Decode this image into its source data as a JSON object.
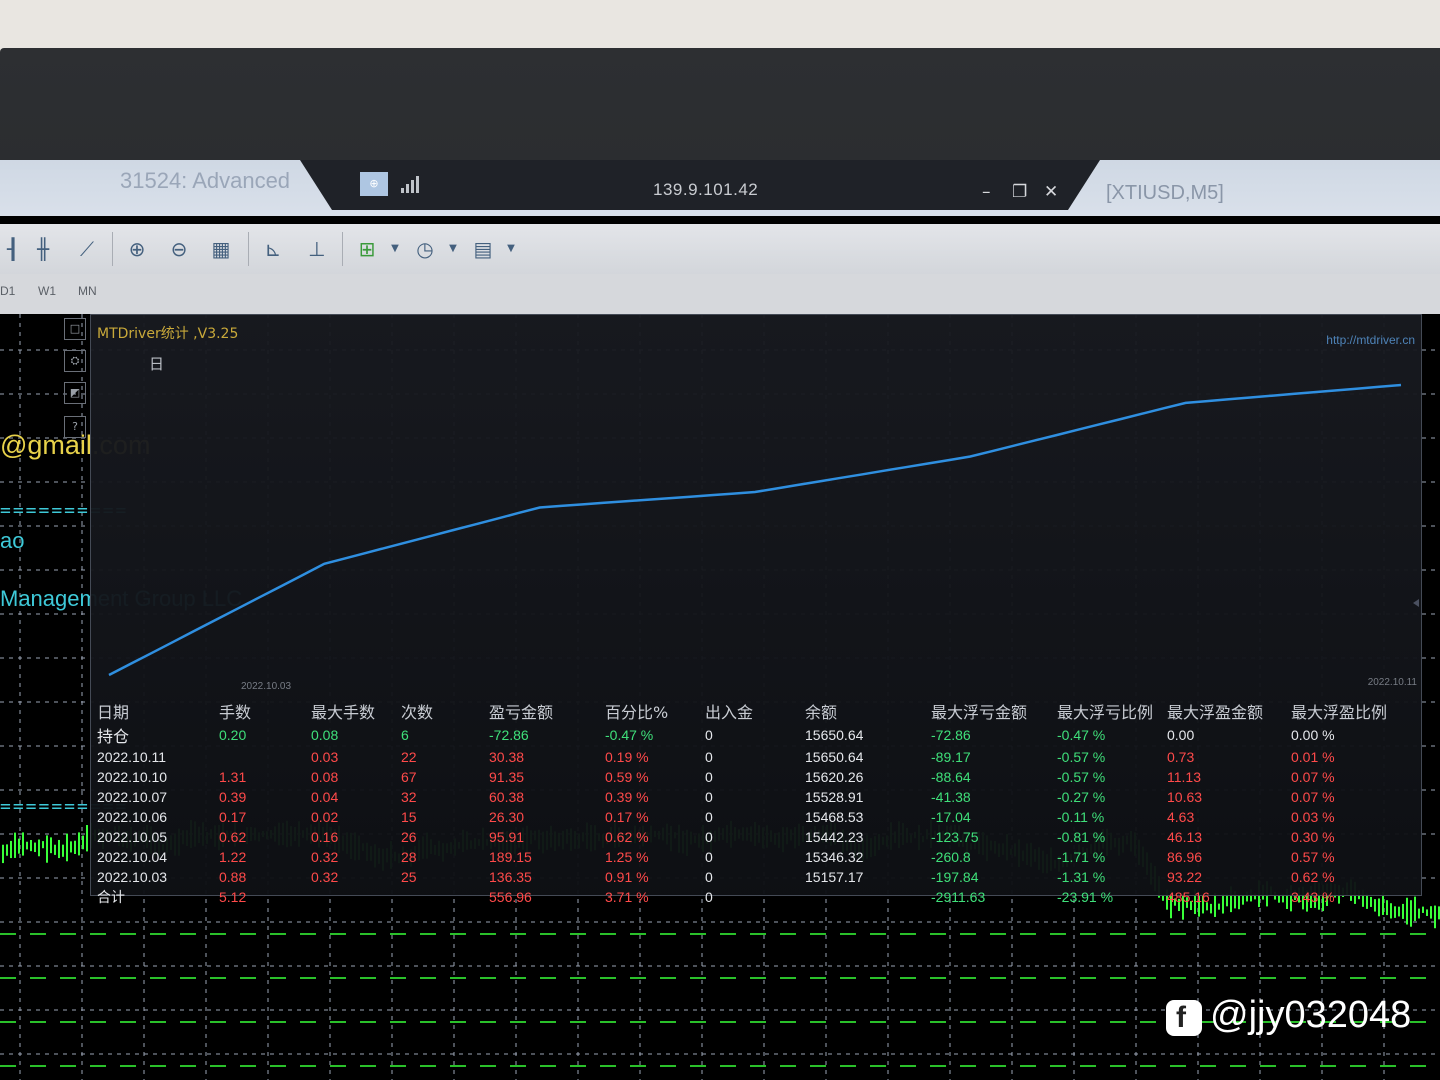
{
  "titlebar": {
    "window_title": "31524: Advanced",
    "rdp_ip": "139.9.101.42",
    "minimize": "–",
    "restore": "❐",
    "close": "✕",
    "symbol": "[XTIUSD,M5]"
  },
  "toolbar": {
    "icons": [
      "bar-chart-icon",
      "candlestick-icon",
      "line-chart-icon",
      "zoom-in-icon",
      "zoom-out-icon",
      "tile-windows-icon",
      "chart-shift-icon",
      "autoscroll-icon",
      "indicators-icon",
      "periods-icon",
      "templates-icon"
    ]
  },
  "timeframes": [
    "D1",
    "W1",
    "MN"
  ],
  "sidebar_glyphs": [
    "□",
    "⛭",
    "◩",
    "?"
  ],
  "left_text": {
    "email": "@gmail.com",
    "separator": "==========",
    "partial_name": "ao",
    "company": "Management Group LLC",
    "separator2": "=========="
  },
  "panel": {
    "title": "MTDriver统计 ,V3.25",
    "url": "http://mtdriver.cn",
    "day_tab": "日",
    "date_start": "2022.10.03",
    "date_end": "2022.10.11",
    "columns": [
      "日期",
      "手数",
      "最大手数",
      "次数",
      "盈亏金额",
      "百分比%",
      "出入金",
      "余额",
      "最大浮亏金额",
      "最大浮亏比例",
      "最大浮盈金额",
      "最大浮盈比例"
    ],
    "rows": [
      [
        "持仓",
        "0.20",
        "0.08",
        "6",
        "-72.86",
        "-0.47 %",
        "0",
        "15650.64",
        "-72.86",
        "-0.47 %",
        "0.00",
        "0.00 %"
      ],
      [
        "2022.10.11",
        "",
        "0.03",
        "22",
        "30.38",
        "0.19 %",
        "0",
        "15650.64",
        "-89.17",
        "-0.57 %",
        "0.73",
        "0.01 %"
      ],
      [
        "2022.10.10",
        "1.31",
        "0.08",
        "67",
        "91.35",
        "0.59 %",
        "0",
        "15620.26",
        "-88.64",
        "-0.57 %",
        "11.13",
        "0.07 %"
      ],
      [
        "2022.10.07",
        "0.39",
        "0.04",
        "32",
        "60.38",
        "0.39 %",
        "0",
        "15528.91",
        "-41.38",
        "-0.27 %",
        "10.63",
        "0.07 %"
      ],
      [
        "2022.10.06",
        "0.17",
        "0.02",
        "15",
        "26.30",
        "0.17 %",
        "0",
        "15468.53",
        "-17.04",
        "-0.11 %",
        "4.63",
        "0.03 %"
      ],
      [
        "2022.10.05",
        "0.62",
        "0.16",
        "26",
        "95.91",
        "0.62 %",
        "0",
        "15442.23",
        "-123.75",
        "-0.81 %",
        "46.13",
        "0.30 %"
      ],
      [
        "2022.10.04",
        "1.22",
        "0.32",
        "28",
        "189.15",
        "1.25 %",
        "0",
        "15346.32",
        "-260.8",
        "-1.71 %",
        "86.96",
        "0.57 %"
      ],
      [
        "2022.10.03",
        "0.88",
        "0.32",
        "25",
        "136.35",
        "0.91 %",
        "0",
        "15157.17",
        "-197.84",
        "-1.31 %",
        "93.22",
        "0.62 %"
      ],
      [
        "合计",
        "5.12",
        "",
        "",
        "556.96",
        "3.71 %",
        "0",
        "",
        "-2911.63",
        "-23.91 %",
        "485.16",
        "3.43 %"
      ]
    ]
  },
  "equity_curve": [
    15157.17,
    15346.32,
    15442.23,
    15468.53,
    15528.91,
    15620.26,
    15650.64
  ],
  "watermark": "@jjy032048",
  "colors": {
    "gain": "#3fe07a",
    "loss": "#ff4a4a",
    "curve": "#2f8fe0",
    "candle": "#39ff39"
  }
}
